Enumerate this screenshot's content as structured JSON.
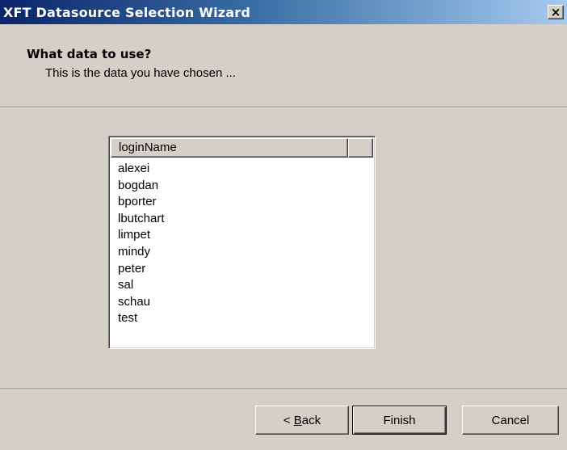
{
  "window": {
    "title": "XFT Datasource Selection Wizard",
    "close_glyph": "×",
    "close_icon": "close-icon"
  },
  "wizard": {
    "heading": "What data to use?",
    "subheading": "This is the data you have chosen ..."
  },
  "list": {
    "columns": [
      "loginName",
      ""
    ],
    "rows": [
      "alexei",
      "bogdan",
      "bporter",
      "lbutchart",
      "limpet",
      "mindy",
      "peter",
      "sal",
      "schau",
      "test"
    ]
  },
  "buttons": {
    "back_prefix": "< ",
    "back_mnemonic": "B",
    "back_rest": "ack",
    "finish": "Finish",
    "cancel": "Cancel",
    "default": "finish"
  },
  "colors": {
    "title_gradient_start": "#0a246a",
    "title_gradient_end": "#a6caf0",
    "dialog_face": "#d4d0c8",
    "list_background": "#ffffff"
  }
}
